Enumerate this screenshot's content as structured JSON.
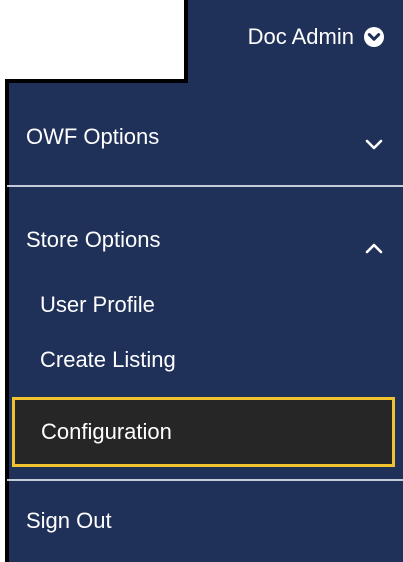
{
  "user_menu": {
    "username": "Doc Admin",
    "toggle_icon": "chevron-down-circle-icon"
  },
  "menu": {
    "owf_options": {
      "label": "OWF Options",
      "expanded": false,
      "icon": "chevron-down-icon"
    },
    "store_options": {
      "label": "Store Options",
      "expanded": true,
      "icon": "chevron-up-icon",
      "items": [
        {
          "label": "User Profile"
        },
        {
          "label": "Create Listing"
        },
        {
          "label": "Configuration",
          "focused": true
        }
      ]
    },
    "sign_out": {
      "label": "Sign Out"
    }
  },
  "colors": {
    "panel_bg": "#1f3059",
    "outline": "#000000",
    "divider": "#c4ccd8",
    "focus_border": "#f2c12e",
    "focused_item_bg": "#262626",
    "text": "#ffffff"
  }
}
